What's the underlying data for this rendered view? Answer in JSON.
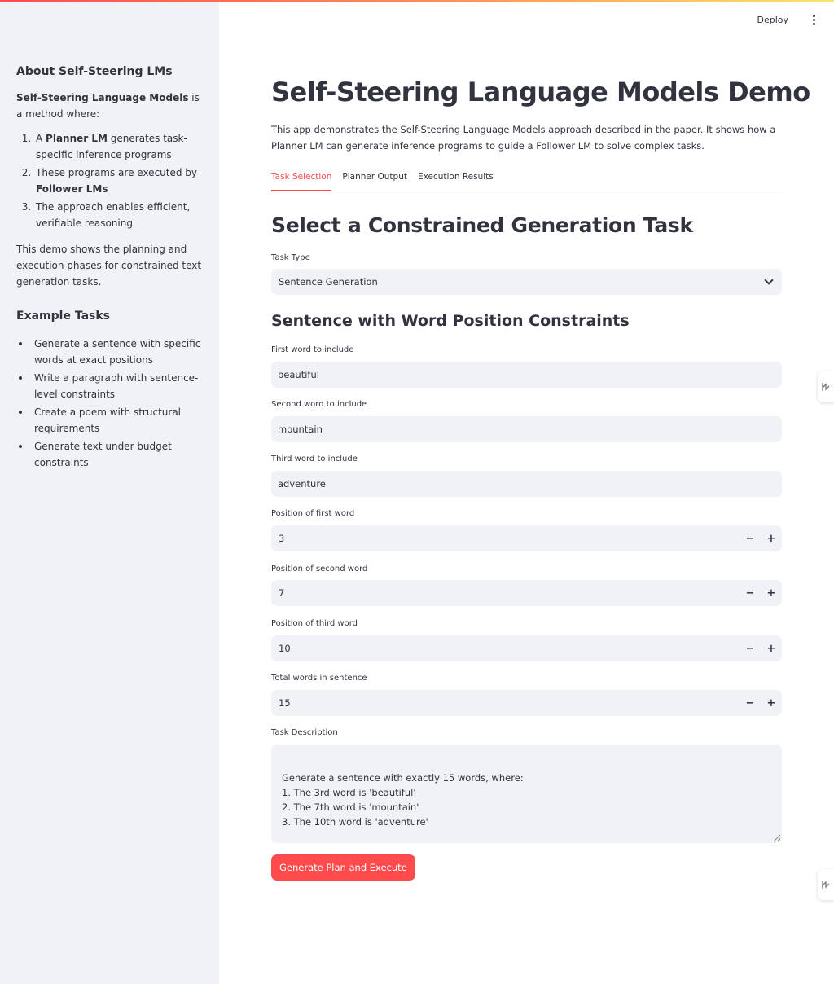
{
  "header": {
    "deploy_label": "Deploy"
  },
  "sidebar": {
    "about_title": "About Self-Steering LMs",
    "intro_bold": "Self-Steering Language Models",
    "intro_rest": " is a method where:",
    "steps": [
      {
        "prefix": "A ",
        "bold": "Planner LM",
        "suffix": " generates task-specific inference programs"
      },
      {
        "prefix": "These programs are executed by ",
        "bold": "Follower LMs",
        "suffix": ""
      },
      {
        "prefix": "The approach enables efficient, verifiable reasoning",
        "bold": "",
        "suffix": ""
      }
    ],
    "demo_text": "This demo shows the planning and execution phases for constrained text generation tasks.",
    "examples_title": "Example Tasks",
    "examples": [
      "Generate a sentence with specific words at exact positions",
      "Write a paragraph with sentence-level constraints",
      "Create a poem with structural requirements",
      "Generate text under budget constraints"
    ]
  },
  "main": {
    "title": "Self-Steering Language Models Demo",
    "intro": "This app demonstrates the Self-Steering Language Models approach described in the paper. It shows how a Planner LM can generate inference programs to guide a Follower LM to solve complex tasks.",
    "tabs": [
      {
        "label": "Task Selection",
        "active": true
      },
      {
        "label": "Planner Output",
        "active": false
      },
      {
        "label": "Execution Results",
        "active": false
      }
    ],
    "section_title": "Select a Constrained Generation Task",
    "task_type_label": "Task Type",
    "task_type_value": "Sentence Generation",
    "subsection_title": "Sentence with Word Position Constraints",
    "first_word_label": "First word to include",
    "first_word_value": "beautiful",
    "second_word_label": "Second word to include",
    "second_word_value": "mountain",
    "third_word_label": "Third word to include",
    "third_word_value": "adventure",
    "pos_first_label": "Position of first word",
    "pos_first_value": "3",
    "pos_second_label": "Position of second word",
    "pos_second_value": "7",
    "pos_third_label": "Position of third word",
    "pos_third_value": "10",
    "total_label": "Total words in sentence",
    "total_value": "15",
    "minus_symbol": "−",
    "plus_symbol": "+",
    "desc_label": "Task Description",
    "desc_value": "Generate a sentence with exactly 15 words, where:\n1. The 3rd word is 'beautiful'\n2. The 7th word is 'mountain'\n3. The 10th word is 'adventure'",
    "button_label": "Generate Plan and Execute"
  },
  "colors": {
    "accent": "#ff4b4b",
    "sidebar_bg": "#f0f2f6",
    "text": "#31333f"
  }
}
